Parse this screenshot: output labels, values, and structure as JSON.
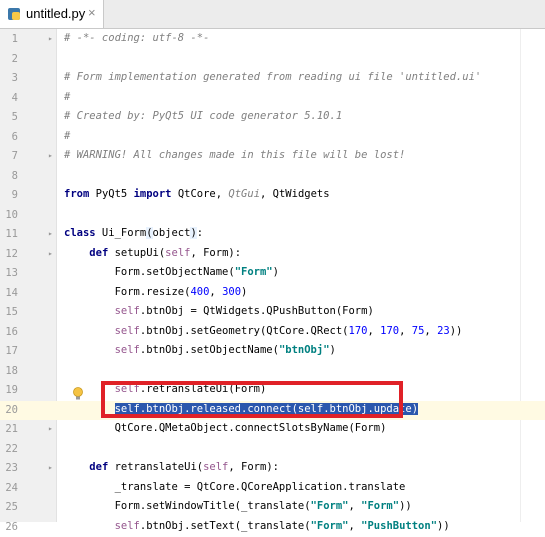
{
  "tab": {
    "title": "untitled.py",
    "close": "×"
  },
  "lines": [
    {
      "n": "1",
      "segs": [
        {
          "t": "# -*- coding: utf-8 -*-",
          "c": "comment"
        }
      ]
    },
    {
      "n": "2",
      "segs": []
    },
    {
      "n": "3",
      "segs": [
        {
          "t": "# Form implementation generated from reading ui file 'untitled.ui'",
          "c": "comment"
        }
      ]
    },
    {
      "n": "4",
      "segs": [
        {
          "t": "#",
          "c": "comment"
        }
      ]
    },
    {
      "n": "5",
      "segs": [
        {
          "t": "# Created by: PyQt5 UI code generator 5.10.1",
          "c": "comment"
        }
      ]
    },
    {
      "n": "6",
      "segs": [
        {
          "t": "#",
          "c": "comment"
        }
      ]
    },
    {
      "n": "7",
      "segs": [
        {
          "t": "# WARNING! All changes made in this file will be lost!",
          "c": "comment"
        }
      ]
    },
    {
      "n": "8",
      "segs": []
    },
    {
      "n": "9",
      "segs": [
        {
          "t": "from",
          "c": "kw"
        },
        {
          "t": " PyQt5 "
        },
        {
          "t": "import",
          "c": "kw"
        },
        {
          "t": " QtCore, "
        },
        {
          "t": "QtGui",
          "c": "comment"
        },
        {
          "t": ", QtWidgets"
        }
      ]
    },
    {
      "n": "10",
      "segs": []
    },
    {
      "n": "11",
      "segs": [
        {
          "t": "class",
          "c": "kw"
        },
        {
          "t": " Ui_Form"
        },
        {
          "t": "(",
          "c": "paren"
        },
        {
          "t": "object"
        },
        {
          "t": ")",
          "c": "paren"
        },
        {
          "t": ":"
        }
      ]
    },
    {
      "n": "12",
      "segs": [
        {
          "t": "    "
        },
        {
          "t": "def",
          "c": "kw"
        },
        {
          "t": " setupUi("
        },
        {
          "t": "self",
          "c": "self"
        },
        {
          "t": ", Form):"
        }
      ]
    },
    {
      "n": "13",
      "segs": [
        {
          "t": "        Form.setObjectName("
        },
        {
          "t": "\"Form\"",
          "c": "str"
        },
        {
          "t": ")"
        }
      ]
    },
    {
      "n": "14",
      "segs": [
        {
          "t": "        Form.resize("
        },
        {
          "t": "400",
          "c": "num"
        },
        {
          "t": ", "
        },
        {
          "t": "300",
          "c": "num"
        },
        {
          "t": ")"
        }
      ]
    },
    {
      "n": "15",
      "segs": [
        {
          "t": "        "
        },
        {
          "t": "self",
          "c": "self"
        },
        {
          "t": ".btnObj = QtWidgets.QPushButton(Form)"
        }
      ]
    },
    {
      "n": "16",
      "segs": [
        {
          "t": "        "
        },
        {
          "t": "self",
          "c": "self"
        },
        {
          "t": ".btnObj.setGeometry(QtCore.QRect("
        },
        {
          "t": "170",
          "c": "num"
        },
        {
          "t": ", "
        },
        {
          "t": "170",
          "c": "num"
        },
        {
          "t": ", "
        },
        {
          "t": "75",
          "c": "num"
        },
        {
          "t": ", "
        },
        {
          "t": "23",
          "c": "num"
        },
        {
          "t": "))"
        }
      ]
    },
    {
      "n": "17",
      "segs": [
        {
          "t": "        "
        },
        {
          "t": "self",
          "c": "self"
        },
        {
          "t": ".btnObj.setObjectName("
        },
        {
          "t": "\"btnObj\"",
          "c": "str"
        },
        {
          "t": ")"
        }
      ]
    },
    {
      "n": "18",
      "segs": []
    },
    {
      "n": "19",
      "segs": [
        {
          "t": "        "
        },
        {
          "t": "self",
          "c": "self"
        },
        {
          "t": ".retranslateUi(Form)"
        }
      ]
    },
    {
      "n": "20",
      "segs": [
        {
          "t": "        "
        },
        {
          "t": "self.btnObj.released.connect(self.btnObj.update)",
          "c": "sel"
        }
      ],
      "current": true
    },
    {
      "n": "21",
      "segs": [
        {
          "t": "        QtCore.QMetaObject.connectSlotsByName(Form)"
        }
      ]
    },
    {
      "n": "22",
      "segs": []
    },
    {
      "n": "23",
      "segs": [
        {
          "t": "    "
        },
        {
          "t": "def",
          "c": "kw"
        },
        {
          "t": " retranslateUi("
        },
        {
          "t": "self",
          "c": "self"
        },
        {
          "t": ", Form):"
        }
      ]
    },
    {
      "n": "24",
      "segs": [
        {
          "t": "        _translate = QtCore.QCoreApplication.translate"
        }
      ]
    },
    {
      "n": "25",
      "segs": [
        {
          "t": "        Form.setWindowTitle(_translate("
        },
        {
          "t": "\"Form\"",
          "c": "str"
        },
        {
          "t": ", "
        },
        {
          "t": "\"Form\"",
          "c": "str"
        },
        {
          "t": "))"
        }
      ]
    },
    {
      "n": "26",
      "segs": [
        {
          "t": "        "
        },
        {
          "t": "self",
          "c": "self"
        },
        {
          "t": ".btnObj.setText(_translate("
        },
        {
          "t": "\"Form\"",
          "c": "str"
        },
        {
          "t": ", "
        },
        {
          "t": "\"PushButton\"",
          "c": "str"
        },
        {
          "t": "))"
        }
      ]
    }
  ]
}
